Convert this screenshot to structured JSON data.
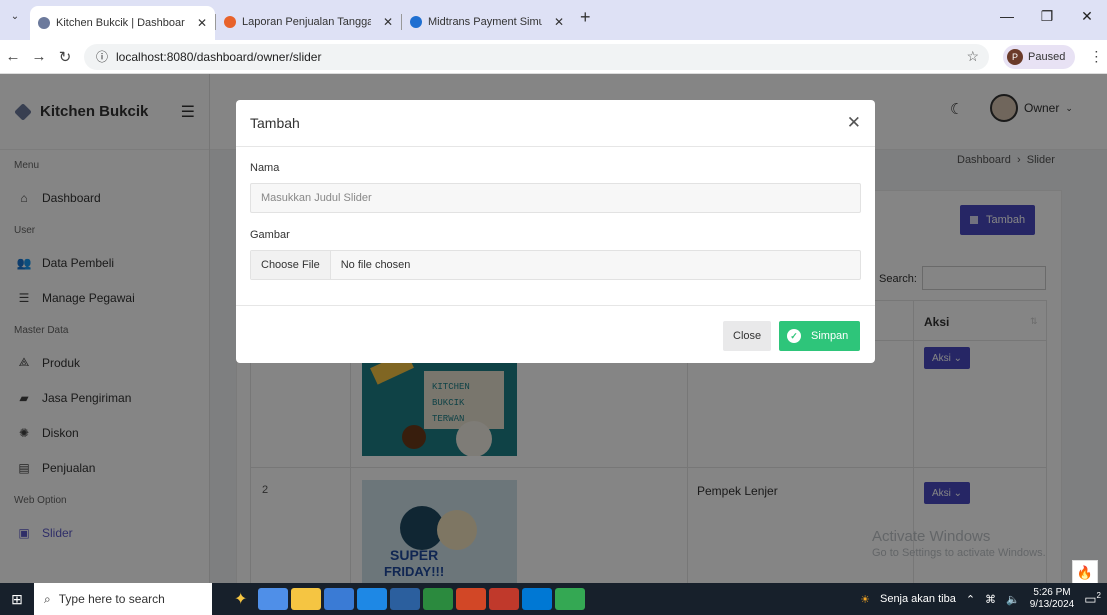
{
  "browser": {
    "tabs": [
      {
        "title": "Kitchen Bukcik | Dashboard Ow",
        "color": "#6c7a9c",
        "active": true
      },
      {
        "title": "Laporan Penjualan Tanggal 202",
        "color": "#e8622a",
        "active": false
      },
      {
        "title": "Midtrans Payment Simulator",
        "color": "#1f6fd1",
        "active": false
      }
    ],
    "url": "localhost:8080/dashboard/owner/slider",
    "profile_status": "Paused"
  },
  "app": {
    "brand": "Kitchen Bukcik",
    "user_name": "Owner",
    "breadcrumb": {
      "home": "Dashboard",
      "current": "Slider"
    },
    "sidebar": [
      {
        "type": "heading",
        "label": "Menu"
      },
      {
        "type": "item",
        "label": "Dashboard",
        "icon": "home-icon",
        "glyph": "⌂"
      },
      {
        "type": "heading",
        "label": "User"
      },
      {
        "type": "item",
        "label": "Data Pembeli",
        "icon": "users-icon",
        "glyph": "👥"
      },
      {
        "type": "item",
        "label": "Manage Pegawai",
        "icon": "user-list-icon",
        "glyph": "☰"
      },
      {
        "type": "heading",
        "label": "Master Data"
      },
      {
        "type": "item",
        "label": "Produk",
        "icon": "product-icon",
        "glyph": "⟁"
      },
      {
        "type": "item",
        "label": "Jasa Pengiriman",
        "icon": "truck-icon",
        "glyph": "▰"
      },
      {
        "type": "item",
        "label": "Diskon",
        "icon": "discount-icon",
        "glyph": "✺"
      },
      {
        "type": "item",
        "label": "Penjualan",
        "icon": "sales-icon",
        "glyph": "▤"
      },
      {
        "type": "heading",
        "label": "Web Option"
      },
      {
        "type": "item",
        "label": "Slider",
        "icon": "slider-icon",
        "glyph": "▣",
        "active": true
      }
    ],
    "content": {
      "add_button": "Tambah",
      "search_label": "Search:",
      "aksi_header": "Aksi",
      "action_button": "Aksi ⌄",
      "rows": [
        {
          "no": "",
          "name": "",
          "image_text": [
            "KITCHEN",
            "BUKCIK",
            "TERWAN"
          ]
        },
        {
          "no": "2",
          "name": "Pempek Lenjer",
          "image_text": [
            "SUPER",
            "FRIDAY!!!"
          ]
        }
      ]
    }
  },
  "modal": {
    "title": "Tambah",
    "name_label": "Nama",
    "name_placeholder": "Masukkan Judul Slider",
    "image_label": "Gambar",
    "file_button": "Choose File",
    "file_status": "No file chosen",
    "close_button": "Close",
    "save_button": "Simpan"
  },
  "watermark": {
    "line1": "Activate Windows",
    "line2": "Go to Settings to activate Windows."
  },
  "taskbar": {
    "search_placeholder": "Type here to search",
    "weather": "Senja akan tiba",
    "time": "5:26 PM",
    "date": "9/13/2024",
    "notification_count": "2",
    "apps": [
      "#4f8fe8",
      "#f5c542",
      "#3a7bd5",
      "#1e88e5",
      "#2b5f9e",
      "#2b8a3e",
      "#d24726",
      "#c0392b",
      "#0078d4",
      "#34a853"
    ]
  },
  "colors": {
    "accent": "#4a4ac2",
    "success": "#2ec57a",
    "overlay": "rgba(0,0,0,0.48)"
  }
}
